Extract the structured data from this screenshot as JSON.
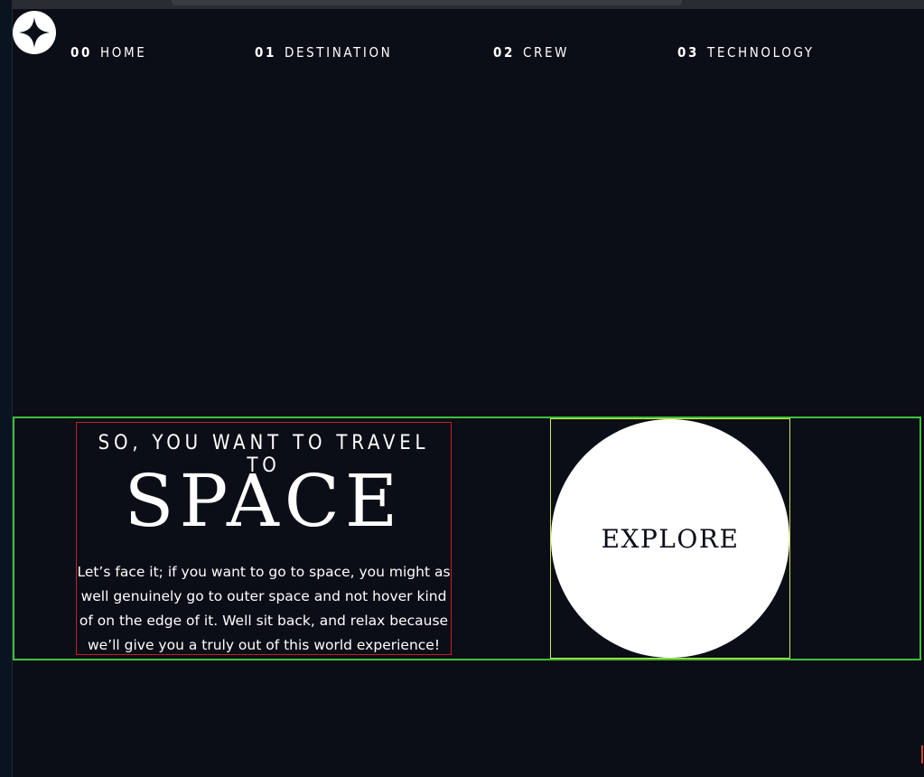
{
  "nav": {
    "items": [
      {
        "num": "00",
        "label": "HOME"
      },
      {
        "num": "01",
        "label": "DESTINATION"
      },
      {
        "num": "02",
        "label": "CREW"
      },
      {
        "num": "03",
        "label": "TECHNOLOGY"
      }
    ]
  },
  "hero": {
    "eyebrow": "SO, YOU WANT TO TRAVEL TO",
    "headline": "SPACE",
    "blurb": "Let’s face it; if you want to go to space, you might as well genuinely go to outer space and not hover kind of on the edge of it. Well sit back, and relax because we’ll give you a truly out of this world experience!",
    "explore_label": "EXPLORE"
  },
  "icons": {
    "logo": "star-logo-icon"
  },
  "colors": {
    "background": "#0b0d17",
    "text": "#ffffff",
    "hero_outline": "#3bc23b",
    "text_outline": "#c5202a",
    "button_outline": "#d8e84a"
  }
}
